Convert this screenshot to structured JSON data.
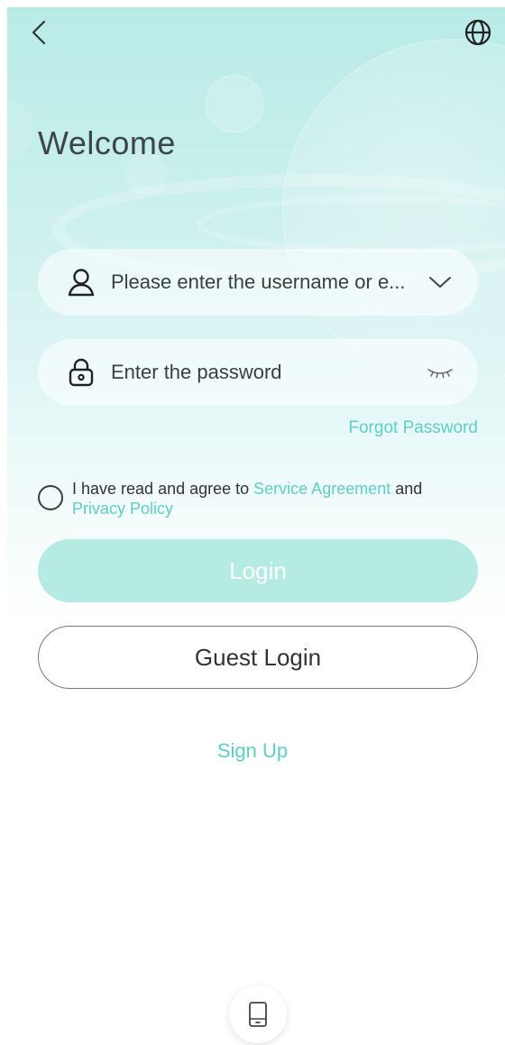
{
  "header": {
    "back_icon": "chevron-left-icon",
    "language_icon": "globe-icon"
  },
  "welcome": "Welcome",
  "username": {
    "icon": "user-icon",
    "placeholder": "Please enter the username or e...",
    "dropdown_icon": "chevron-down-icon"
  },
  "password": {
    "icon": "lock-icon",
    "placeholder": "Enter the password",
    "toggle_icon": "eye-closed-icon"
  },
  "forgot_password": "Forgot Password",
  "agreement": {
    "prefix": "I have read and agree to ",
    "service_agreement": "Service Agreement",
    "and": " and ",
    "privacy_policy": "Privacy Policy",
    "checked": false
  },
  "login_label": "Login",
  "guest_login_label": "Guest Login",
  "sign_up_label": "Sign Up",
  "footer": {
    "phone_icon": "phone-icon"
  },
  "colors": {
    "accent": "#5ecfc4",
    "login_button": "#b5ebe3"
  }
}
